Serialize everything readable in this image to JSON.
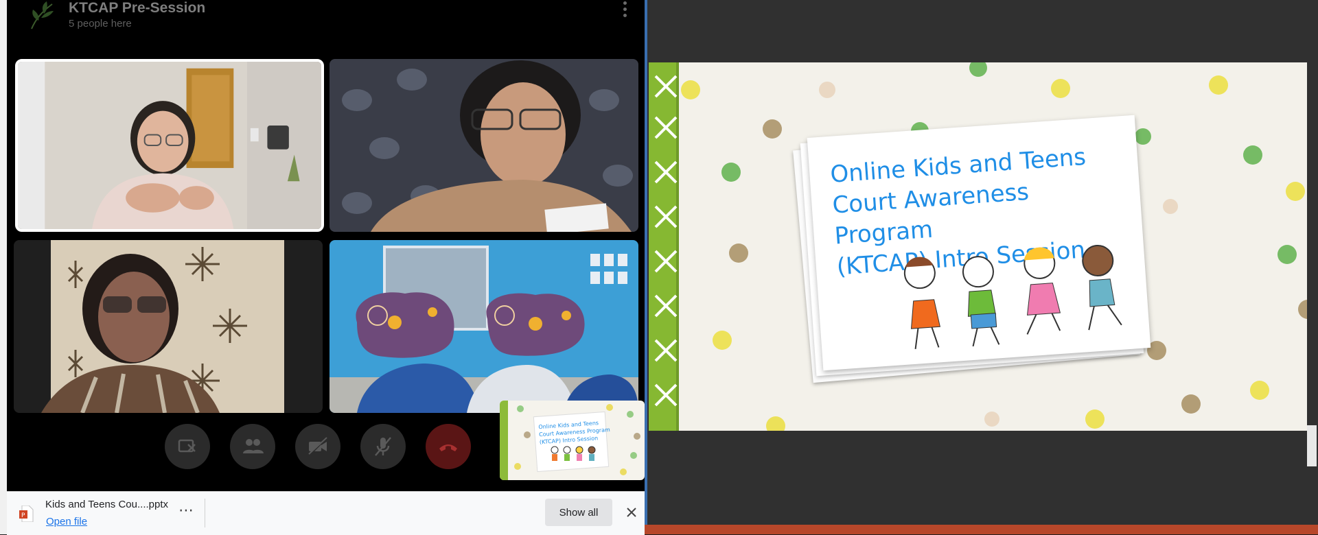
{
  "call": {
    "title": "KTCAP Pre-Session",
    "subtitle": "5 people here"
  },
  "download": {
    "file_name": "Kids and Teens Cou....pptx",
    "open_label": "Open file",
    "more_label": "⋯",
    "show_all_label": "Show all",
    "close_label": "✕"
  },
  "slide": {
    "title_line1": "Online Kids and Teens",
    "title_line2": "Court Awareness Program",
    "title_line3": "(KTCAP) Intro Session"
  },
  "pip": {
    "line1": "Online Kids and Teens",
    "line2": "Court Awareness Program",
    "line3": "(KTCAP) Intro Session"
  },
  "colors": {
    "accent_blue": "#1f8ee6",
    "end_call": "#5a1515",
    "link": "#1a73e8",
    "ppt_taskbar": "#b7472a"
  },
  "icons": {
    "group": "leaf-group-icon",
    "menu": "kebab-menu-icon",
    "screen_share_off": "screen-share-off-icon",
    "participants": "participants-icon",
    "camera_off": "camera-off-icon",
    "mic_off": "mic-off-icon",
    "end_call": "phone-hangup-icon",
    "file": "pptx-file-icon"
  }
}
